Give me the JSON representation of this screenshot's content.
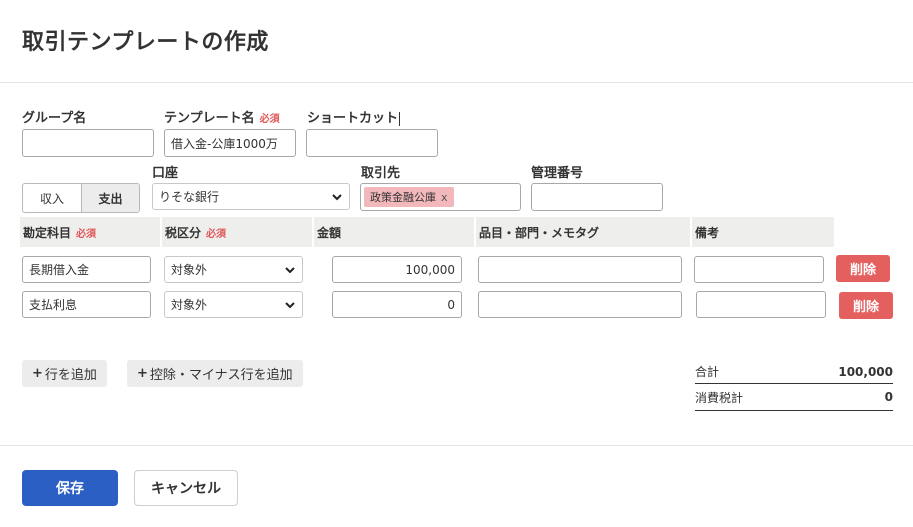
{
  "header": {
    "title": "取引テンプレートの作成"
  },
  "form": {
    "group_name": {
      "label": "グループ名",
      "value": ""
    },
    "template_name": {
      "label": "テンプレート名",
      "required": "必須",
      "value": "借入金-公庫1000万"
    },
    "shortcut": {
      "label": "ショートカット",
      "value": ""
    },
    "type_toggle": {
      "income": "収入",
      "expense": "支出",
      "selected": "expense"
    },
    "account": {
      "label": "口座",
      "value": "りそな銀行"
    },
    "partner": {
      "label": "取引先",
      "tag": "政策金融公庫",
      "tag_remove": "x"
    },
    "ref_number": {
      "label": "管理番号",
      "value": ""
    }
  },
  "table": {
    "headers": {
      "account_item": "勘定科目",
      "account_item_req": "必須",
      "tax": "税区分",
      "tax_req": "必須",
      "amount": "金額",
      "item_memo": "品目・部門・メモタグ",
      "notes": "備考"
    },
    "rows": [
      {
        "account_item": "長期借入金",
        "tax": "対象外",
        "amount": "100,000",
        "item_memo": "",
        "notes": "",
        "delete": "削除"
      },
      {
        "account_item": "支払利息",
        "tax": "対象外",
        "amount": "0",
        "item_memo": "",
        "notes": "",
        "delete": "削除"
      }
    ]
  },
  "actions": {
    "add_row_plus": "+",
    "add_row": "行を追加",
    "add_deduction_plus": "+",
    "add_deduction": "控除・マイナス行を追加"
  },
  "summary": {
    "total_label": "合計",
    "total_value": "100,000",
    "tax_label": "消費税計",
    "tax_value": "0"
  },
  "footer": {
    "save": "保存",
    "cancel": "キャンセル"
  },
  "colors": {
    "primary": "#2b5fc3",
    "danger": "#e4605f",
    "tag": "#f2b8bb",
    "required": "#e0575b"
  }
}
